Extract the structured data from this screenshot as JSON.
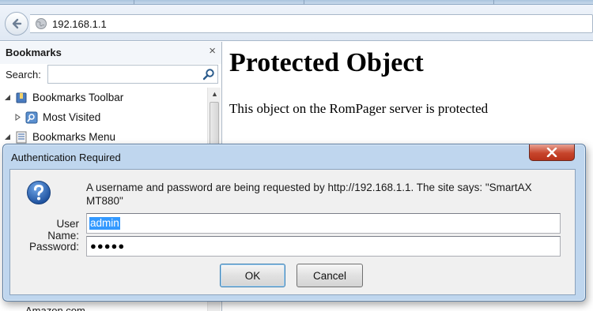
{
  "browser": {
    "url": "192.168.1.1"
  },
  "sidebar": {
    "title": "Bookmarks",
    "close_glyph": "×",
    "search_label": "Search:",
    "search_value": "",
    "items": [
      {
        "label": "Bookmarks Toolbar",
        "icon": "bookmarks-toolbar-icon",
        "expanded": true
      },
      {
        "label": "Most Visited",
        "icon": "smart-folder-icon",
        "expanded": false
      },
      {
        "label": "Bookmarks Menu",
        "icon": "bookmarks-menu-icon",
        "expanded": true
      }
    ],
    "partial_item": "Amazon.com"
  },
  "page": {
    "heading": "Protected Object",
    "message": "This object on the RomPager server is protected"
  },
  "dialog": {
    "title": "Authentication Required",
    "message_line1": "A username and password are being requested by http://192.168.1.1. The site says: \"SmartAX",
    "message_line2": "MT880\"",
    "username_label": "User Name:",
    "username_value": "admin",
    "password_label": "Password:",
    "password_mask": "●●●●●",
    "ok_label": "OK",
    "cancel_label": "Cancel"
  },
  "colors": {
    "dialog_frame": "#bfd6ee",
    "close_button": "#c7452c",
    "selection": "#3399ff"
  }
}
